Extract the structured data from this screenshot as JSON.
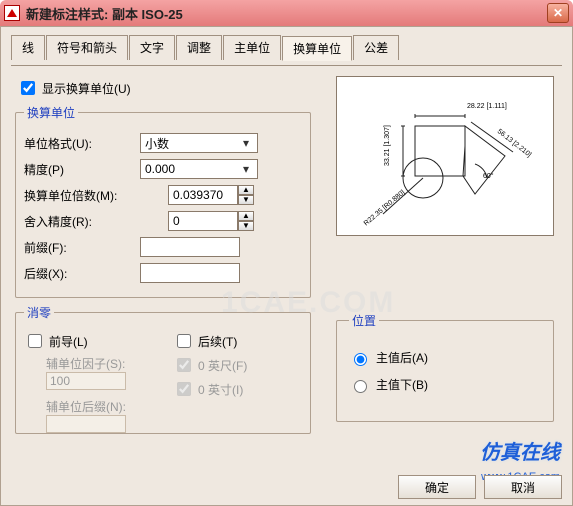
{
  "title": "新建标注样式: 副本 ISO-25",
  "tabs": [
    "线",
    "符号和箭头",
    "文字",
    "调整",
    "主单位",
    "换算单位",
    "公差"
  ],
  "active_tab": 5,
  "show_alt_units_label": "显示换算单位(U)",
  "show_alt_units_checked": true,
  "group_alt_units": "换算单位",
  "group_zero": "消零",
  "group_position": "位置",
  "labels": {
    "unit_format": "单位格式(U):",
    "precision": "精度(P)",
    "mult": "换算单位倍数(M):",
    "round": "舍入精度(R):",
    "prefix": "前缀(F):",
    "suffix": "后缀(X):",
    "leading": "前导(L)",
    "trailing": "后续(T)",
    "subfactor": "辅单位因子(S):",
    "feet": "0 英尺(F)",
    "inches": "0 英寸(I)",
    "subsuffix": "辅单位后缀(N):"
  },
  "values": {
    "unit_format": "小数",
    "precision": "0.000",
    "mult": "0.039370",
    "round": "0",
    "prefix": "",
    "suffix": "",
    "subfactor": "100",
    "subsuffix": ""
  },
  "checks": {
    "leading": false,
    "trailing": false,
    "feet": true,
    "inches": true
  },
  "position": {
    "after": "主值后(A)",
    "below": "主值下(B)",
    "selected": "after"
  },
  "preview": {
    "top_dim": "28.22 [1.111]",
    "left_dim": "33.21 [1.307]",
    "diag_dim": "56.13 [2.210]",
    "angle": "60°",
    "radius": "R22.35 [R0.880]"
  },
  "buttons": {
    "ok": "确定",
    "cancel": "取消"
  },
  "watermark_logo": "仿真在线",
  "watermark_url": "www.1CAE.com",
  "watermark_center": "1CAE.COM"
}
